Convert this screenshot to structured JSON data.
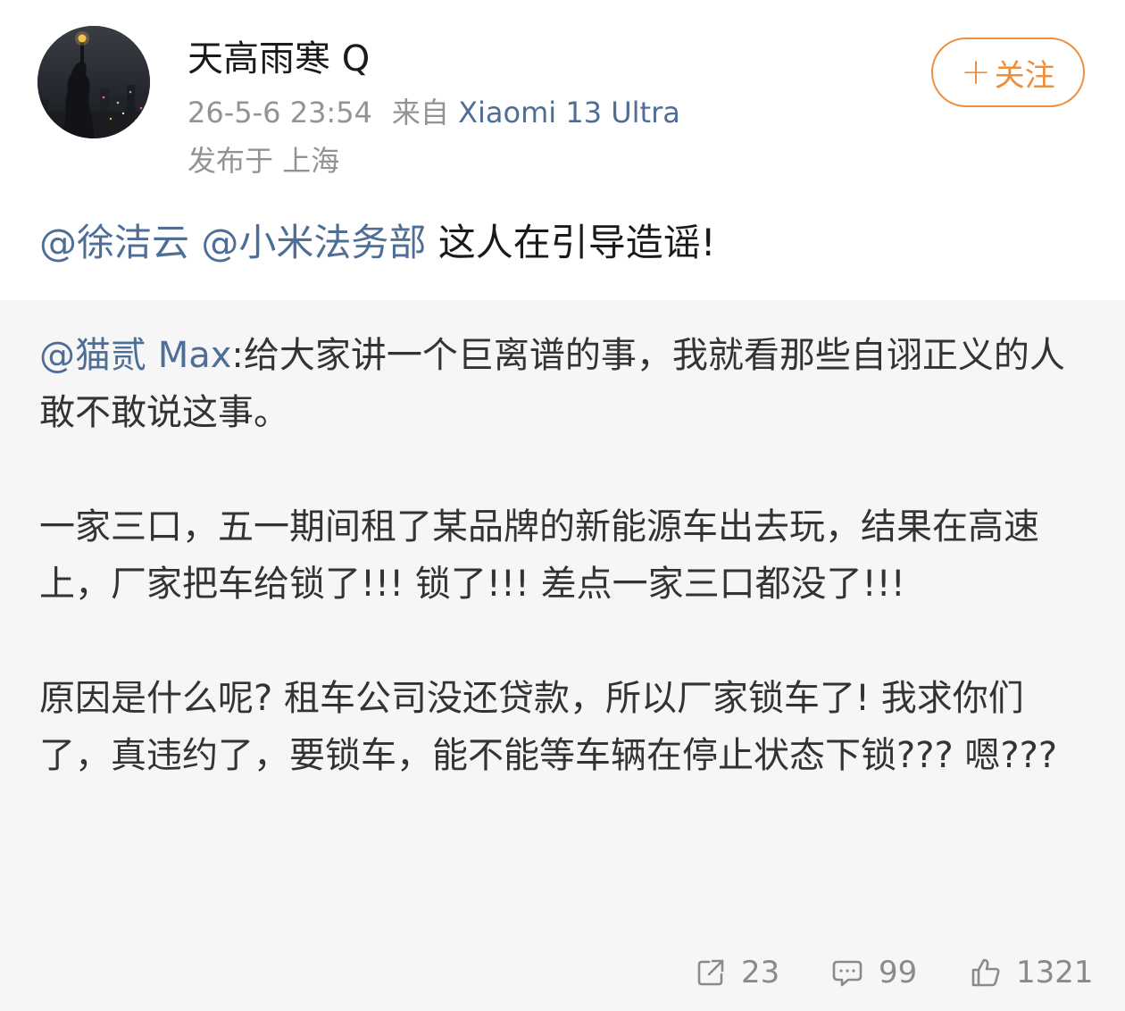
{
  "post": {
    "username": "天高雨寒 Q",
    "timestamp": "26-5-6 23:54",
    "source_label": "来自",
    "device": "Xiaomi 13 Ultra",
    "location": "发布于 上海",
    "follow_label": "关注",
    "mentions": [
      "@徐洁云",
      "@小米法务部"
    ],
    "text": "这人在引导造谣!"
  },
  "repost": {
    "author_mention": "@猫贰 Max",
    "paragraph_1": ":给大家讲一个巨离谱的事，我就看那些自诩正义的人敢不敢说这事。",
    "paragraph_2": "一家三口，五一期间租了某品牌的新能源车出去玩，结果在高速上，厂家把车给锁了!!! 锁了!!! 差点一家三口都没了!!!",
    "paragraph_3": "原因是什么呢? 租车公司没还贷款，所以厂家锁车了! 我求你们了，真违约了，要锁车，能不能等车辆在停止状态下锁??? 嗯???"
  },
  "actions": {
    "share_count": "23",
    "comment_count": "99",
    "like_count": "1321"
  },
  "colors": {
    "link": "#4f6e96",
    "follow_accent": "#f08d3a",
    "meta_text": "#939393",
    "repost_bg": "#f6f6f6"
  },
  "icons": [
    "avatar-image",
    "plus-icon",
    "share-icon",
    "comment-icon",
    "like-icon"
  ]
}
